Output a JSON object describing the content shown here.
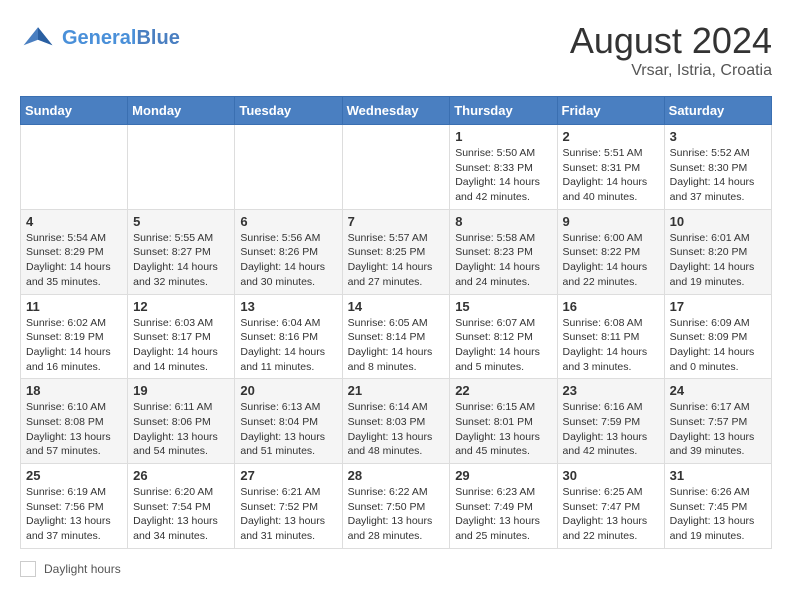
{
  "header": {
    "logo_general": "General",
    "logo_blue": "Blue",
    "month": "August 2024",
    "location": "Vrsar, Istria, Croatia"
  },
  "days_of_week": [
    "Sunday",
    "Monday",
    "Tuesday",
    "Wednesday",
    "Thursday",
    "Friday",
    "Saturday"
  ],
  "weeks": [
    [
      {
        "day": "",
        "info": ""
      },
      {
        "day": "",
        "info": ""
      },
      {
        "day": "",
        "info": ""
      },
      {
        "day": "",
        "info": ""
      },
      {
        "day": "1",
        "info": "Sunrise: 5:50 AM\nSunset: 8:33 PM\nDaylight: 14 hours and 42 minutes."
      },
      {
        "day": "2",
        "info": "Sunrise: 5:51 AM\nSunset: 8:31 PM\nDaylight: 14 hours and 40 minutes."
      },
      {
        "day": "3",
        "info": "Sunrise: 5:52 AM\nSunset: 8:30 PM\nDaylight: 14 hours and 37 minutes."
      }
    ],
    [
      {
        "day": "4",
        "info": "Sunrise: 5:54 AM\nSunset: 8:29 PM\nDaylight: 14 hours and 35 minutes."
      },
      {
        "day": "5",
        "info": "Sunrise: 5:55 AM\nSunset: 8:27 PM\nDaylight: 14 hours and 32 minutes."
      },
      {
        "day": "6",
        "info": "Sunrise: 5:56 AM\nSunset: 8:26 PM\nDaylight: 14 hours and 30 minutes."
      },
      {
        "day": "7",
        "info": "Sunrise: 5:57 AM\nSunset: 8:25 PM\nDaylight: 14 hours and 27 minutes."
      },
      {
        "day": "8",
        "info": "Sunrise: 5:58 AM\nSunset: 8:23 PM\nDaylight: 14 hours and 24 minutes."
      },
      {
        "day": "9",
        "info": "Sunrise: 6:00 AM\nSunset: 8:22 PM\nDaylight: 14 hours and 22 minutes."
      },
      {
        "day": "10",
        "info": "Sunrise: 6:01 AM\nSunset: 8:20 PM\nDaylight: 14 hours and 19 minutes."
      }
    ],
    [
      {
        "day": "11",
        "info": "Sunrise: 6:02 AM\nSunset: 8:19 PM\nDaylight: 14 hours and 16 minutes."
      },
      {
        "day": "12",
        "info": "Sunrise: 6:03 AM\nSunset: 8:17 PM\nDaylight: 14 hours and 14 minutes."
      },
      {
        "day": "13",
        "info": "Sunrise: 6:04 AM\nSunset: 8:16 PM\nDaylight: 14 hours and 11 minutes."
      },
      {
        "day": "14",
        "info": "Sunrise: 6:05 AM\nSunset: 8:14 PM\nDaylight: 14 hours and 8 minutes."
      },
      {
        "day": "15",
        "info": "Sunrise: 6:07 AM\nSunset: 8:12 PM\nDaylight: 14 hours and 5 minutes."
      },
      {
        "day": "16",
        "info": "Sunrise: 6:08 AM\nSunset: 8:11 PM\nDaylight: 14 hours and 3 minutes."
      },
      {
        "day": "17",
        "info": "Sunrise: 6:09 AM\nSunset: 8:09 PM\nDaylight: 14 hours and 0 minutes."
      }
    ],
    [
      {
        "day": "18",
        "info": "Sunrise: 6:10 AM\nSunset: 8:08 PM\nDaylight: 13 hours and 57 minutes."
      },
      {
        "day": "19",
        "info": "Sunrise: 6:11 AM\nSunset: 8:06 PM\nDaylight: 13 hours and 54 minutes."
      },
      {
        "day": "20",
        "info": "Sunrise: 6:13 AM\nSunset: 8:04 PM\nDaylight: 13 hours and 51 minutes."
      },
      {
        "day": "21",
        "info": "Sunrise: 6:14 AM\nSunset: 8:03 PM\nDaylight: 13 hours and 48 minutes."
      },
      {
        "day": "22",
        "info": "Sunrise: 6:15 AM\nSunset: 8:01 PM\nDaylight: 13 hours and 45 minutes."
      },
      {
        "day": "23",
        "info": "Sunrise: 6:16 AM\nSunset: 7:59 PM\nDaylight: 13 hours and 42 minutes."
      },
      {
        "day": "24",
        "info": "Sunrise: 6:17 AM\nSunset: 7:57 PM\nDaylight: 13 hours and 39 minutes."
      }
    ],
    [
      {
        "day": "25",
        "info": "Sunrise: 6:19 AM\nSunset: 7:56 PM\nDaylight: 13 hours and 37 minutes."
      },
      {
        "day": "26",
        "info": "Sunrise: 6:20 AM\nSunset: 7:54 PM\nDaylight: 13 hours and 34 minutes."
      },
      {
        "day": "27",
        "info": "Sunrise: 6:21 AM\nSunset: 7:52 PM\nDaylight: 13 hours and 31 minutes."
      },
      {
        "day": "28",
        "info": "Sunrise: 6:22 AM\nSunset: 7:50 PM\nDaylight: 13 hours and 28 minutes."
      },
      {
        "day": "29",
        "info": "Sunrise: 6:23 AM\nSunset: 7:49 PM\nDaylight: 13 hours and 25 minutes."
      },
      {
        "day": "30",
        "info": "Sunrise: 6:25 AM\nSunset: 7:47 PM\nDaylight: 13 hours and 22 minutes."
      },
      {
        "day": "31",
        "info": "Sunrise: 6:26 AM\nSunset: 7:45 PM\nDaylight: 13 hours and 19 minutes."
      }
    ]
  ],
  "footer": {
    "daylight_label": "Daylight hours"
  }
}
